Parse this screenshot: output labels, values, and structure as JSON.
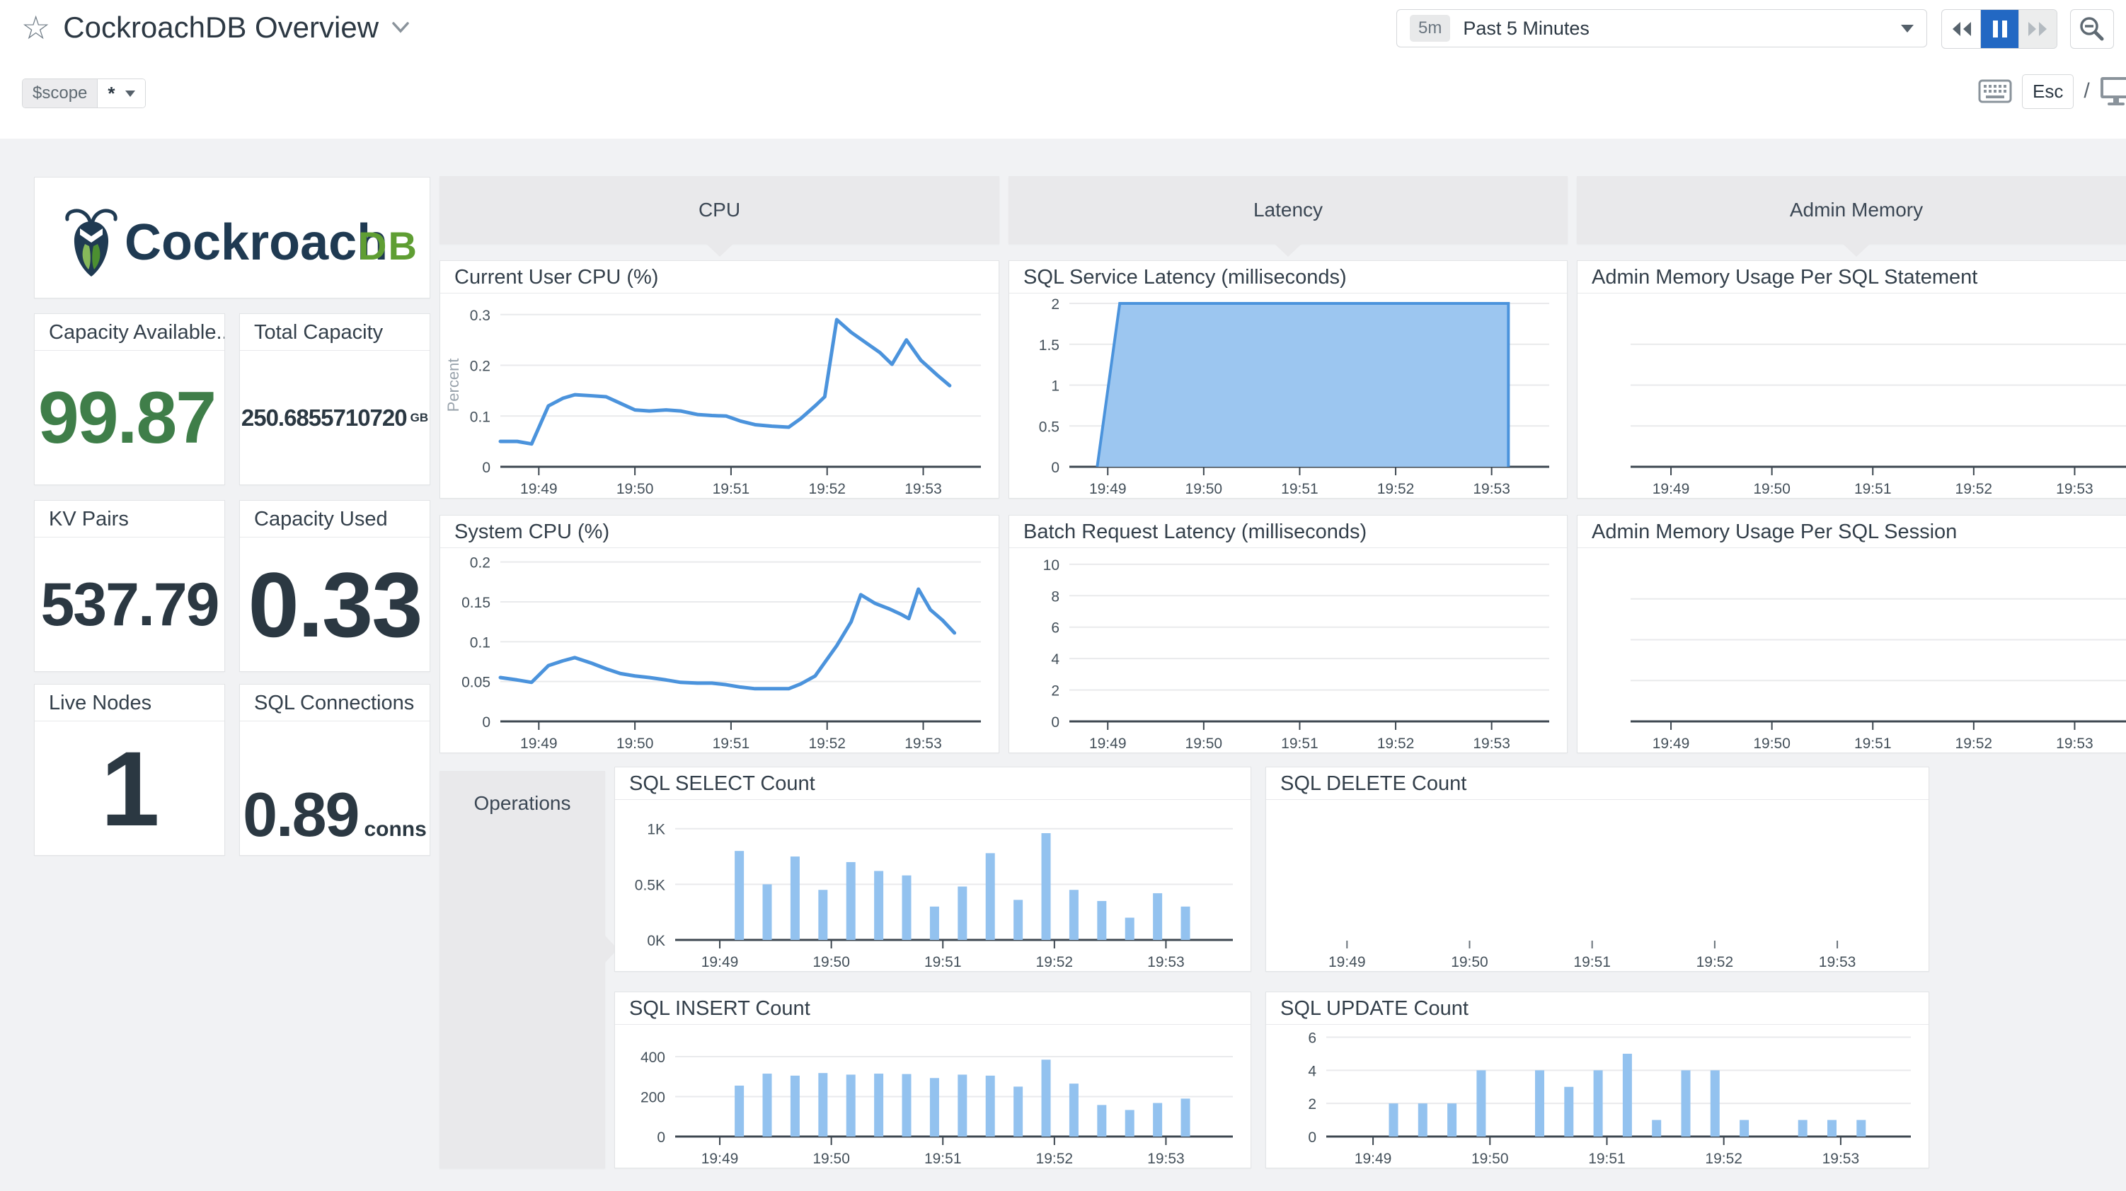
{
  "colors": {
    "accent_blue": "#2268c3",
    "line_blue": "#4b93dc",
    "area_fill": "#9cc6f0",
    "bar_blue": "#93c2ef",
    "stat_green": "#3f7e49",
    "stat_dark": "#2b3842",
    "group_gray": "#e9e9eb",
    "page_gray": "#f1f2f4",
    "grid": "#e9eaec",
    "axis": "#3d4750",
    "tick_text": "#44505a",
    "muted_label": "#99a3ac",
    "logo_navy": "#1f3a52",
    "logo_green": "#5f9e33"
  },
  "header": {
    "title": "CockroachDB Overview",
    "time_badge": "5m",
    "time_label": "Past 5 Minutes",
    "esc": "Esc",
    "slash": "/"
  },
  "scope_bar": {
    "name": "$scope",
    "value": "*"
  },
  "logo": {
    "word": "Cockroach",
    "suffix": "DB"
  },
  "groups": [
    {
      "label": "CPU"
    },
    {
      "label": "Latency"
    },
    {
      "label": "Admin Memory"
    },
    {
      "label": "Operations"
    }
  ],
  "stats": [
    {
      "title": "Capacity Available...",
      "value": "99.87",
      "unit": "",
      "value_color": "#3f7e49"
    },
    {
      "title": "Total Capacity",
      "value": "250.6855710720",
      "unit": "GB",
      "value_color": "#2b3842"
    },
    {
      "title": "KV Pairs",
      "value": "537.79",
      "unit": "",
      "value_color": "#2b3842"
    },
    {
      "title": "Capacity Used",
      "value": "0.33",
      "unit": "",
      "value_color": "#2b3842"
    },
    {
      "title": "Live Nodes",
      "value": "1",
      "unit": "",
      "value_color": "#2b3842"
    },
    {
      "title": "SQL Connections",
      "value": "0.89",
      "unit": "conns",
      "value_color": "#2b3842"
    }
  ],
  "time_axis": {
    "labels": [
      "19:49",
      "19:50",
      "19:51",
      "19:52",
      "19:53"
    ],
    "fracs": [
      0.08,
      0.28,
      0.48,
      0.68,
      0.88
    ]
  },
  "chart_data": [
    {
      "id": "current-user-cpu",
      "type": "line",
      "title": "Current User CPU (%)",
      "ylabel": "Percent",
      "ymax": 0.322,
      "yticks": [
        {
          "v": 0,
          "label": "0"
        },
        {
          "v": 0.1,
          "label": "0.1"
        },
        {
          "v": 0.2,
          "label": "0.2"
        },
        {
          "v": 0.3,
          "label": "0.3"
        }
      ],
      "points": [
        [
          0.0,
          0.05
        ],
        [
          0.035,
          0.05
        ],
        [
          0.065,
          0.045
        ],
        [
          0.1,
          0.12
        ],
        [
          0.13,
          0.135
        ],
        [
          0.155,
          0.142
        ],
        [
          0.19,
          0.14
        ],
        [
          0.22,
          0.138
        ],
        [
          0.25,
          0.125
        ],
        [
          0.28,
          0.112
        ],
        [
          0.31,
          0.11
        ],
        [
          0.345,
          0.112
        ],
        [
          0.375,
          0.11
        ],
        [
          0.41,
          0.103
        ],
        [
          0.44,
          0.101
        ],
        [
          0.47,
          0.1
        ],
        [
          0.5,
          0.09
        ],
        [
          0.53,
          0.083
        ],
        [
          0.565,
          0.08
        ],
        [
          0.6,
          0.078
        ],
        [
          0.625,
          0.095
        ],
        [
          0.655,
          0.12
        ],
        [
          0.675,
          0.138
        ],
        [
          0.7,
          0.29
        ],
        [
          0.73,
          0.265
        ],
        [
          0.76,
          0.245
        ],
        [
          0.79,
          0.225
        ],
        [
          0.815,
          0.202
        ],
        [
          0.845,
          0.25
        ],
        [
          0.875,
          0.21
        ],
        [
          0.91,
          0.18
        ],
        [
          0.935,
          0.16
        ]
      ]
    },
    {
      "id": "system-cpu",
      "type": "line",
      "title": "System CPU (%)",
      "ymax": 0.205,
      "yticks": [
        {
          "v": 0,
          "label": "0"
        },
        {
          "v": 0.05,
          "label": "0.05"
        },
        {
          "v": 0.1,
          "label": "0.1"
        },
        {
          "v": 0.15,
          "label": "0.15"
        },
        {
          "v": 0.2,
          "label": "0.2"
        }
      ],
      "points": [
        [
          0.0,
          0.055
        ],
        [
          0.035,
          0.052
        ],
        [
          0.065,
          0.049
        ],
        [
          0.1,
          0.07
        ],
        [
          0.13,
          0.076
        ],
        [
          0.155,
          0.08
        ],
        [
          0.19,
          0.073
        ],
        [
          0.22,
          0.066
        ],
        [
          0.25,
          0.06
        ],
        [
          0.28,
          0.057
        ],
        [
          0.31,
          0.055
        ],
        [
          0.345,
          0.052
        ],
        [
          0.375,
          0.049
        ],
        [
          0.41,
          0.048
        ],
        [
          0.44,
          0.048
        ],
        [
          0.47,
          0.046
        ],
        [
          0.5,
          0.043
        ],
        [
          0.53,
          0.041
        ],
        [
          0.565,
          0.041
        ],
        [
          0.6,
          0.041
        ],
        [
          0.625,
          0.047
        ],
        [
          0.655,
          0.057
        ],
        [
          0.7,
          0.095
        ],
        [
          0.73,
          0.125
        ],
        [
          0.75,
          0.159
        ],
        [
          0.78,
          0.148
        ],
        [
          0.81,
          0.141
        ],
        [
          0.835,
          0.134
        ],
        [
          0.85,
          0.129
        ],
        [
          0.87,
          0.166
        ],
        [
          0.895,
          0.14
        ],
        [
          0.92,
          0.127
        ],
        [
          0.945,
          0.111
        ]
      ]
    },
    {
      "id": "sql-service-latency",
      "type": "area",
      "title": "SQL Service Latency (milliseconds)",
      "ymax": 2.0,
      "yticks": [
        {
          "v": 0,
          "label": "0"
        },
        {
          "v": 0.5,
          "label": "0.5"
        },
        {
          "v": 1,
          "label": "1"
        },
        {
          "v": 1.5,
          "label": "1.5"
        },
        {
          "v": 2,
          "label": "2"
        }
      ],
      "points": [
        [
          0.058,
          0
        ],
        [
          0.105,
          2
        ],
        [
          0.915,
          2
        ],
        [
          0.915,
          0
        ]
      ]
    },
    {
      "id": "batch-request-latency",
      "type": "empty",
      "title": "Batch Request Latency (milliseconds)",
      "ymax": 10.4,
      "yticks": [
        {
          "v": 0,
          "label": "0"
        },
        {
          "v": 2,
          "label": "2"
        },
        {
          "v": 4,
          "label": "4"
        },
        {
          "v": 6,
          "label": "6"
        },
        {
          "v": 8,
          "label": "8"
        },
        {
          "v": 10,
          "label": "10"
        }
      ]
    },
    {
      "id": "admin-memory-statement",
      "type": "empty",
      "title": "Admin Memory Usage Per SQL Statement",
      "yticks": [],
      "grid_fracs": [
        0.25,
        0.5,
        0.75
      ],
      "full_bleed": true,
      "margin_left": 75
    },
    {
      "id": "admin-memory-session",
      "type": "empty",
      "title": "Admin Memory Usage Per SQL Session",
      "yticks": [],
      "grid_fracs": [
        0.25,
        0.5,
        0.75
      ],
      "full_bleed": true,
      "margin_left": 75
    },
    {
      "id": "sql-select-count",
      "type": "bar",
      "title": "SQL SELECT Count",
      "ymax": 1170,
      "x_start": "19:49:15",
      "x_interval_seconds": 15,
      "yticks": [
        {
          "v": 0,
          "label": "0K"
        },
        {
          "v": 500,
          "label": "0.5K"
        },
        {
          "v": 1000,
          "label": "1K"
        }
      ],
      "values": [
        800,
        500,
        750,
        450,
        700,
        620,
        580,
        300,
        480,
        780,
        360,
        960,
        450,
        350,
        200,
        420,
        300
      ]
    },
    {
      "id": "sql-delete-count",
      "type": "empty",
      "title": "SQL DELETE Count",
      "yticks": [],
      "baseline": false,
      "margin_left": 45
    },
    {
      "id": "sql-insert-count",
      "type": "bar",
      "title": "SQL INSERT Count",
      "ymax": 510,
      "x_start": "19:49:15",
      "x_interval_seconds": 15,
      "yticks": [
        {
          "v": 0,
          "label": "0"
        },
        {
          "v": 200,
          "label": "200"
        },
        {
          "v": 400,
          "label": "400"
        }
      ],
      "values": [
        255,
        315,
        305,
        318,
        310,
        315,
        313,
        293,
        310,
        305,
        250,
        385,
        265,
        158,
        133,
        168,
        190
      ]
    },
    {
      "id": "sql-update-count",
      "type": "bar",
      "title": "SQL UPDATE Count",
      "ymax": 6.15,
      "x_start": "19:49:15",
      "x_interval_seconds": 15,
      "yticks": [
        {
          "v": 0,
          "label": "0"
        },
        {
          "v": 2,
          "label": "2"
        },
        {
          "v": 4,
          "label": "4"
        },
        {
          "v": 6,
          "label": "6"
        }
      ],
      "values": [
        2,
        2,
        2,
        4,
        0,
        4,
        3,
        4,
        5,
        1,
        4,
        4,
        1,
        0,
        1,
        1,
        1
      ]
    }
  ]
}
